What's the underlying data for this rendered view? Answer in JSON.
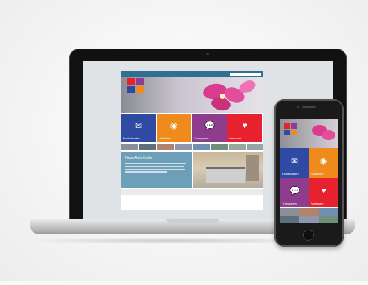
{
  "scene": {
    "background": "#f4f4f4"
  },
  "site": {
    "colors": {
      "blue": "#2f4aa3",
      "orange": "#ef8a1c",
      "purple": "#8e3c8d",
      "red": "#e7222e",
      "teal": "#2f6f92",
      "news_bg": "#6d9fb8",
      "gray": "#8f8f8f",
      "olive": "#8ea38c"
    },
    "tiles": [
      {
        "label": "Kontaktdaten",
        "icon": "mail-icon",
        "color": "#2f4aa3"
      },
      {
        "label": "Vorstellen",
        "icon": "eye-icon",
        "color": "#ef8a1c"
      },
      {
        "label": "Transparenz",
        "icon": "chat-icon",
        "color": "#8e3c8d"
      },
      {
        "label": "Vertrauen",
        "icon": "heart-icon",
        "color": "#e7222e"
      }
    ],
    "subtiles": [
      {
        "color": "#8a8f98"
      },
      {
        "color": "#5e6f7e"
      },
      {
        "color": "#b0846c"
      },
      {
        "color": "#8f95aa"
      },
      {
        "color": "#6e8fb2"
      },
      {
        "color": "#6f8f7b"
      },
      {
        "color": "#9aa79c"
      },
      {
        "color": "#95a4a8"
      }
    ],
    "news": {
      "title": "Neue Aufenthalte"
    }
  },
  "phone_site": {
    "tiles": [
      {
        "label": "Kontaktdaten",
        "icon": "mail-icon",
        "color": "#2f4aa3"
      },
      {
        "label": "Vorstellen",
        "icon": "eye-icon",
        "color": "#ef8a1c"
      },
      {
        "label": "Transparenz",
        "icon": "chat-icon",
        "color": "#8e3c8d"
      },
      {
        "label": "Vertrauen",
        "icon": "heart-icon",
        "color": "#e7222e"
      }
    ]
  }
}
